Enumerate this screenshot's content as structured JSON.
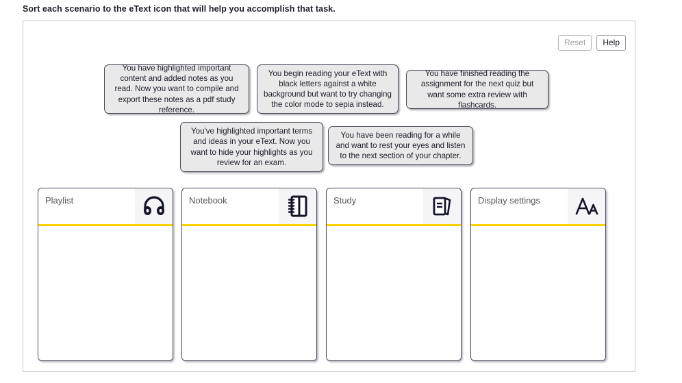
{
  "instruction": "Sort each scenario to the eText icon that will help you accomplish that task.",
  "toolbar": {
    "reset_label": "Reset",
    "help_label": "Help"
  },
  "scenarios": [
    {
      "id": "scenario-1",
      "text": "You have highlighted important content and added notes as you read. Now you want to compile and export these notes as a pdf study reference."
    },
    {
      "id": "scenario-2",
      "text": "You begin reading your eText with black letters against a white background but want to try changing the color mode to sepia instead."
    },
    {
      "id": "scenario-3",
      "text": "You have finished reading the assignment for the next quiz but want some extra review with flashcards."
    },
    {
      "id": "scenario-4",
      "text": "You've highlighted important terms and ideas in your eText. Now you want to hide your highlights as you review for an exam."
    },
    {
      "id": "scenario-5",
      "text": "You have been reading for a while and want to rest your eyes and listen to the next section of your chapter."
    }
  ],
  "columns": [
    {
      "title": "Playlist",
      "icon": "headphones-icon",
      "items": []
    },
    {
      "title": "Notebook",
      "icon": "notebook-icon",
      "items": []
    },
    {
      "title": "Study",
      "icon": "flashcards-icon",
      "items": []
    },
    {
      "title": "Display settings",
      "icon": "text-size-icon",
      "items": []
    }
  ],
  "colors": {
    "accent": "#ffd100",
    "card_fill": "#e9e9e9",
    "card_border": "#4a4a5e",
    "panel_border": "#c6c6c6",
    "title_text": "#585858"
  }
}
